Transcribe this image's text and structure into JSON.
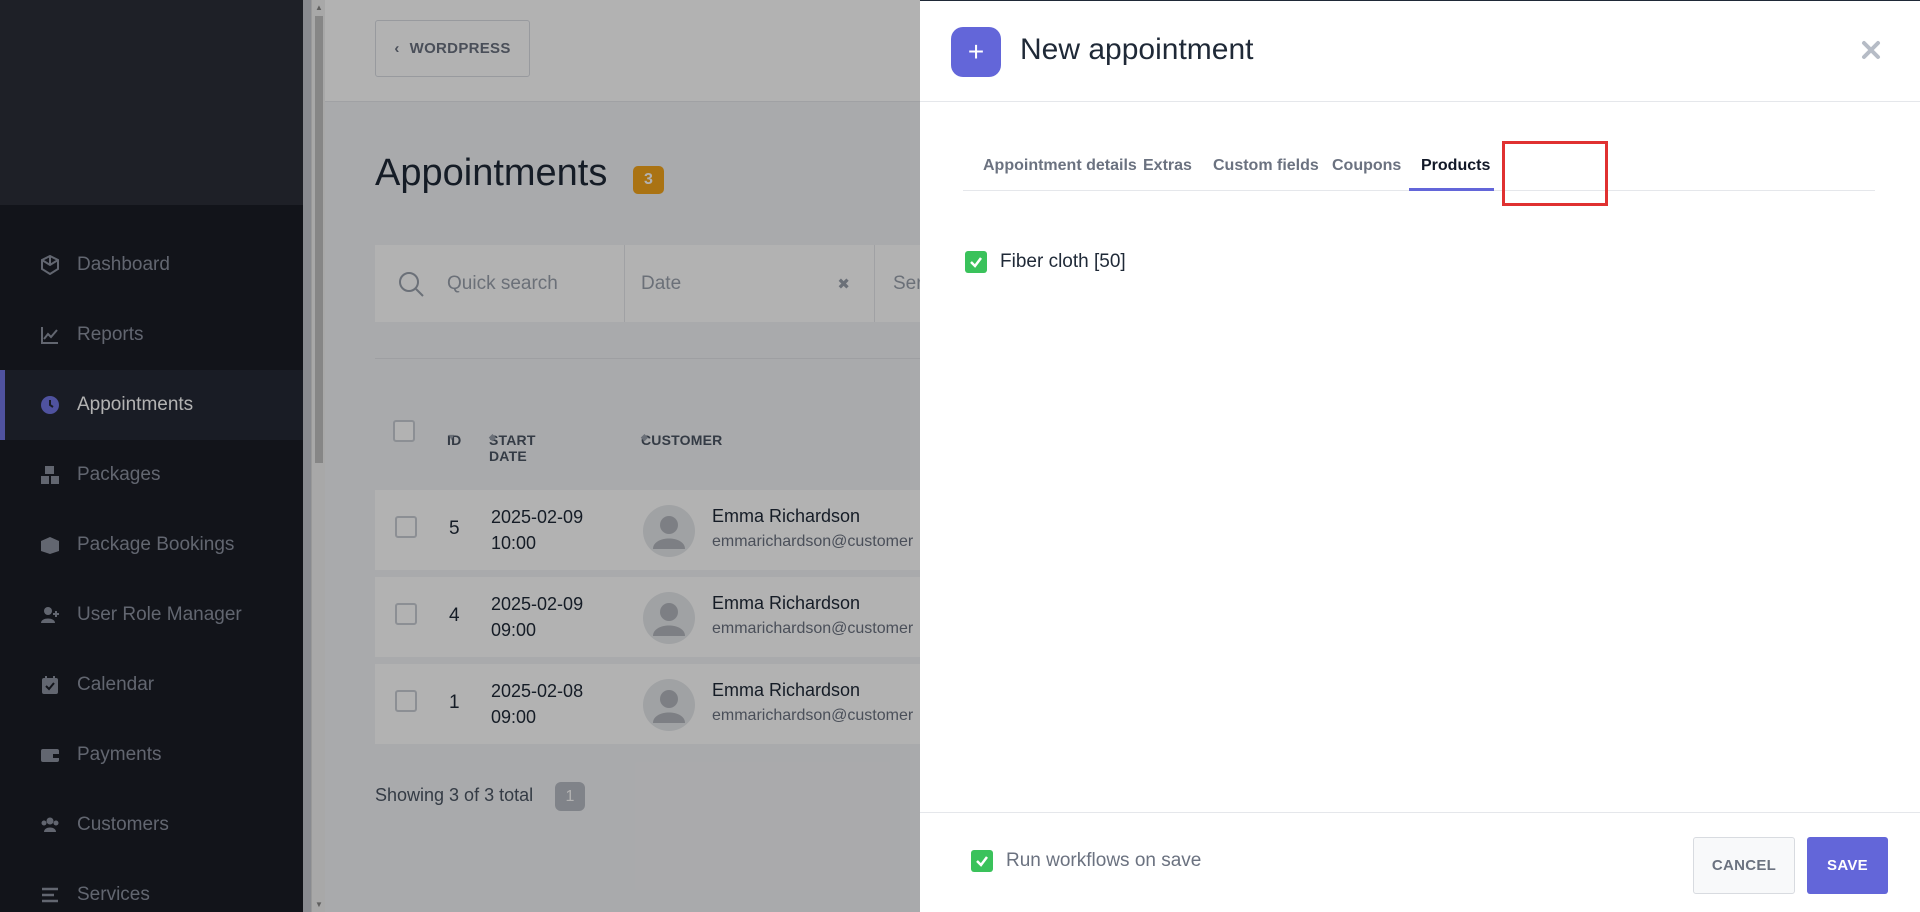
{
  "sidebar": {
    "items": [
      {
        "label": "Dashboard",
        "icon": "box-icon"
      },
      {
        "label": "Reports",
        "icon": "chart-icon"
      },
      {
        "label": "Appointments",
        "icon": "clock-icon"
      },
      {
        "label": "Packages",
        "icon": "boxes-icon"
      },
      {
        "label": "Package Bookings",
        "icon": "package-open-icon"
      },
      {
        "label": "User Role Manager",
        "icon": "user-plus-icon"
      },
      {
        "label": "Calendar",
        "icon": "calendar-icon"
      },
      {
        "label": "Payments",
        "icon": "wallet-icon"
      },
      {
        "label": "Customers",
        "icon": "users-icon"
      },
      {
        "label": "Services",
        "icon": "list-icon"
      }
    ],
    "active_item": "Appointments",
    "active_color": "#7176e4"
  },
  "topbar": {
    "back_label": "WORDPRESS"
  },
  "main": {
    "title": "Appointments",
    "count": "3",
    "filters": {
      "search_placeholder": "Quick search",
      "date_placeholder": "Date",
      "third_partial": "Ser"
    },
    "table": {
      "headers": {
        "id": "ID",
        "start_date": "START DATE",
        "customer": "CUSTOMER"
      },
      "rows": [
        {
          "id": "5",
          "date": "2025-02-09",
          "time": "10:00",
          "name": "Emma Richardson",
          "email": "emmarichardson@customer"
        },
        {
          "id": "4",
          "date": "2025-02-09",
          "time": "09:00",
          "name": "Emma Richardson",
          "email": "emmarichardson@customer"
        },
        {
          "id": "1",
          "date": "2025-02-08",
          "time": "09:00",
          "name": "Emma Richardson",
          "email": "emmarichardson@customer"
        }
      ]
    },
    "showing_text": "Showing 3 of 3 total",
    "page_number": "1"
  },
  "modal": {
    "title": "New appointment",
    "tabs": [
      {
        "label": "Appointment details",
        "active": false
      },
      {
        "label": "Extras",
        "active": false
      },
      {
        "label": "Custom fields",
        "active": false
      },
      {
        "label": "Coupons",
        "active": false
      },
      {
        "label": "Products",
        "active": true
      }
    ],
    "products": [
      {
        "label": "Fiber cloth [50]",
        "checked": true
      }
    ],
    "run_workflows_label": "Run workflows on save",
    "run_workflows_checked": true,
    "cancel_label": "CANCEL",
    "save_label": "SAVE",
    "accent_color": "#6366d9",
    "check_color": "#3ac25b",
    "highlight_color": "#e03131"
  }
}
